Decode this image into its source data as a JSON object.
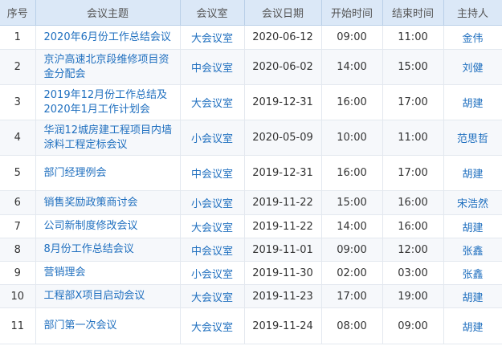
{
  "headers": [
    "序号",
    "会议主题",
    "会议室",
    "会议日期",
    "开始时间",
    "结束时间",
    "主持人"
  ],
  "rows": [
    {
      "no": "1",
      "topic": "2020年6月份工作总结会议",
      "room": "大会议室",
      "date": "2020-06-12",
      "start": "09:00",
      "end": "11:00",
      "host": "金伟"
    },
    {
      "no": "2",
      "topic": "京沪高速北京段维修项目资金分配会",
      "room": "中会议室",
      "date": "2020-06-02",
      "start": "14:00",
      "end": "15:00",
      "host": "刘健"
    },
    {
      "no": "3",
      "topic": "2019年12月份工作总结及2020年1月工作计划会",
      "room": "大会议室",
      "date": "2019-12-31",
      "start": "16:00",
      "end": "17:00",
      "host": "胡建"
    },
    {
      "no": "4",
      "topic": "华润12城房建工程项目内墙涂料工程定标会议",
      "room": "小会议室",
      "date": "2020-05-09",
      "start": "10:00",
      "end": "11:00",
      "host": "范思哲"
    },
    {
      "no": "5",
      "topic": "部门经理例会",
      "room": "中会议室",
      "date": "2019-12-31",
      "start": "16:00",
      "end": "17:00",
      "host": "胡建"
    },
    {
      "no": "6",
      "topic": "销售奖励政策商讨会",
      "room": "小会议室",
      "date": "2019-11-22",
      "start": "15:00",
      "end": "16:00",
      "host": "宋浩然"
    },
    {
      "no": "7",
      "topic": "公司新制度修改会议",
      "room": "大会议室",
      "date": "2019-11-22",
      "start": "14:00",
      "end": "16:00",
      "host": "胡建"
    },
    {
      "no": "8",
      "topic": "8月份工作总结会议",
      "room": "中会议室",
      "date": "2019-11-01",
      "start": "09:00",
      "end": "12:00",
      "host": "张鑫"
    },
    {
      "no": "9",
      "topic": "营销理会",
      "room": "小会议室",
      "date": "2019-11-30",
      "start": "02:00",
      "end": "03:00",
      "host": "张鑫"
    },
    {
      "no": "10",
      "topic": "工程部X项目启动会议",
      "room": "大会议室",
      "date": "2019-11-23",
      "start": "17:00",
      "end": "19:00",
      "host": "胡建"
    },
    {
      "no": "11",
      "topic": "部门第一次会议",
      "room": "大会议室",
      "date": "2019-11-24",
      "start": "08:00",
      "end": "09:00",
      "host": "胡建"
    }
  ]
}
